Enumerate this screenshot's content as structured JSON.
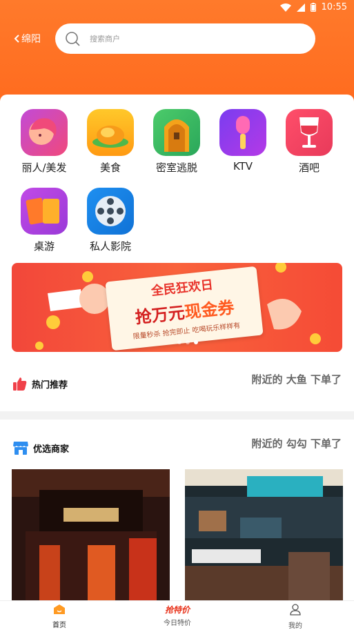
{
  "status": {
    "time": "10:55"
  },
  "header": {
    "location": "绵阳",
    "search_placeholder": "搜索商户"
  },
  "categories": [
    {
      "label": "丽人/美发",
      "icon": "beauty-icon"
    },
    {
      "label": "美食",
      "icon": "food-icon"
    },
    {
      "label": "密室逃脱",
      "icon": "escape-room-icon"
    },
    {
      "label": "KTV",
      "icon": "microphone-icon"
    },
    {
      "label": "酒吧",
      "icon": "wine-glass-icon"
    },
    {
      "label": "桌游",
      "icon": "cards-icon"
    },
    {
      "label": "私人影院",
      "icon": "film-reel-icon"
    }
  ],
  "banner": {
    "line1": "全民狂欢日",
    "line2a": "抢万元",
    "line2b": "现金券",
    "line3": "限量秒杀 抢完即止 吃喝玩乐样样有"
  },
  "hot": {
    "title": "热门推荐",
    "news": "附近的 大鱼 下单了"
  },
  "merchants": {
    "title": "优选商家",
    "news": "附近的 勾勾 下单了"
  },
  "tabbar": [
    {
      "label": "首页",
      "icon": "home-icon"
    },
    {
      "label": "今日特价",
      "icon": "flash-sale-icon",
      "logo_text": "抢特价"
    },
    {
      "label": "我的",
      "icon": "user-icon"
    }
  ],
  "colors": {
    "brand": "#ff6a1e",
    "accent_red": "#f2473a"
  }
}
